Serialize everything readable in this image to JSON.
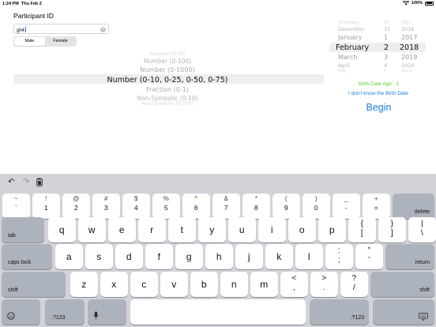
{
  "status": {
    "time": "1:24 PM",
    "date": "Thu Feb 2",
    "battery": "100%"
  },
  "form": {
    "title": "Participant ID",
    "participant_id": "gh4",
    "gender_options": [
      "Male",
      "Female"
    ],
    "selected_gender": "Male"
  },
  "task_picker": {
    "items": [
      "Number (0-10)",
      "Number (0-100)",
      "Number (0-1000)",
      "Number (0-10, 0-25, 0-50, 0-75)",
      "Fraction (0-1)",
      "Non-Symbolic (0-10)",
      "Non-Symbolic (0-100)"
    ],
    "selected": "Number (0-10, 0-25, 0-50, 0-75)"
  },
  "date_picker": {
    "months": [
      "November",
      "December",
      "January",
      "February",
      "March",
      "April",
      "May"
    ],
    "days": [
      "30",
      "31",
      "1",
      "2",
      "3",
      "4",
      "5"
    ],
    "years": [
      "2015",
      "2016",
      "2017",
      "2018",
      "2019",
      "2020",
      "2021"
    ],
    "selected": {
      "month": "February",
      "day": "2",
      "year": "2018"
    }
  },
  "birth_date_age": "Birth Date Age : 5",
  "unknown_birth_date_link": "I don't know the Birth Date",
  "begin_button": "Begin",
  "keyboard": {
    "rows": [
      [
        [
          "~",
          "`"
        ],
        [
          "!",
          "1"
        ],
        [
          "@",
          "2"
        ],
        [
          "#",
          "3"
        ],
        [
          "$",
          "4"
        ],
        [
          "%",
          "5"
        ],
        [
          "^",
          "6"
        ],
        [
          "&",
          "7"
        ],
        [
          "*",
          "8"
        ],
        [
          "(",
          "9"
        ],
        [
          ")",
          "0"
        ],
        [
          "_",
          "-"
        ],
        [
          "+",
          "="
        ]
      ],
      [
        "q",
        "w",
        "e",
        "r",
        "t",
        "y",
        "u",
        "i",
        "o",
        "p",
        [
          "{",
          "["
        ],
        [
          "}",
          "]"
        ],
        [
          "|",
          "\\"
        ]
      ],
      [
        "a",
        "s",
        "d",
        "f",
        "g",
        "h",
        "j",
        "k",
        "l",
        [
          ":",
          ";"
        ],
        [
          "”",
          "’"
        ]
      ],
      [
        "z",
        "x",
        "c",
        "v",
        "b",
        "n",
        "m",
        [
          "<",
          ","
        ],
        [
          ">",
          "."
        ],
        [
          "?",
          "/"
        ]
      ]
    ],
    "delete_label": "delete",
    "tab_label": "tab",
    "caps_lock_label": "caps lock",
    "return_label": "return",
    "shift_label": "shift",
    "num_label": ".?123"
  }
}
